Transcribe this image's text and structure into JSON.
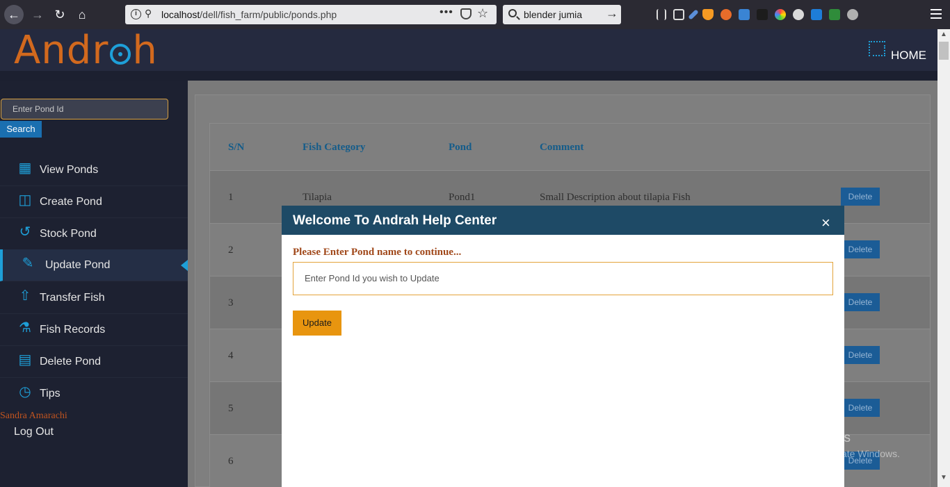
{
  "browser": {
    "url_host": "localhost",
    "url_path": "/dell/fish_farm/public/ponds.php",
    "search_text": "blender jumia",
    "nav_icons": [
      "back-arrow-icon",
      "forward-arrow-icon",
      "reload-icon",
      "home-icon"
    ]
  },
  "header": {
    "logo_left": "Andr",
    "logo_right": "h",
    "home_label": "HOME"
  },
  "sidebar": {
    "search_placeholder": "Enter Pond Id",
    "search_button": "Search",
    "items": [
      {
        "label": "View Ponds",
        "icon": "grid-icon"
      },
      {
        "label": "Create Pond",
        "icon": "basket-icon"
      },
      {
        "label": "Stock Pond",
        "icon": "history-icon"
      },
      {
        "label": "Update Pond",
        "icon": "pencil-icon"
      },
      {
        "label": "Transfer Fish",
        "icon": "transfer-basket-icon"
      },
      {
        "label": "Fish Records",
        "icon": "flask-icon"
      },
      {
        "label": "Delete Pond",
        "icon": "archive-icon"
      },
      {
        "label": "Tips",
        "icon": "clock-history-icon"
      }
    ],
    "active_index": 3,
    "user_name": "Sandra Amarachi",
    "logout_label": "Log Out"
  },
  "table": {
    "headers": [
      "S/N",
      "Fish Category",
      "Pond",
      "Comment"
    ],
    "rows": [
      {
        "sn": "1",
        "category": "Tilapia",
        "pond": "Pond1",
        "comment": "Small Description about tilapia Fish",
        "action": "Delete"
      },
      {
        "sn": "2",
        "category": "",
        "pond": "",
        "comment": "",
        "action": "Delete"
      },
      {
        "sn": "3",
        "category": "",
        "pond": "",
        "comment": "",
        "action": "Delete"
      },
      {
        "sn": "4",
        "category": "",
        "pond": "",
        "comment": "",
        "action": "Delete"
      },
      {
        "sn": "5",
        "category": "",
        "pond": "",
        "comment": "",
        "action": "Delete"
      },
      {
        "sn": "6",
        "category": "",
        "pond": "",
        "comment": "",
        "action": "Delete"
      }
    ]
  },
  "modal": {
    "title": "Welcome To Andrah Help Center",
    "close_symbol": "×",
    "prompt": "Please Enter Pond name to continue...",
    "input_placeholder": "Enter Pond Id you wish to Update",
    "submit_label": "Update"
  },
  "watermark": {
    "line1": "Activate Windows",
    "line2": "Go to Settings to activate Windows."
  },
  "colors": {
    "accent_blue": "#1e9fd8",
    "logo_orange": "#d2691e",
    "modal_header": "#1e4a66",
    "update_button": "#e8950f"
  }
}
